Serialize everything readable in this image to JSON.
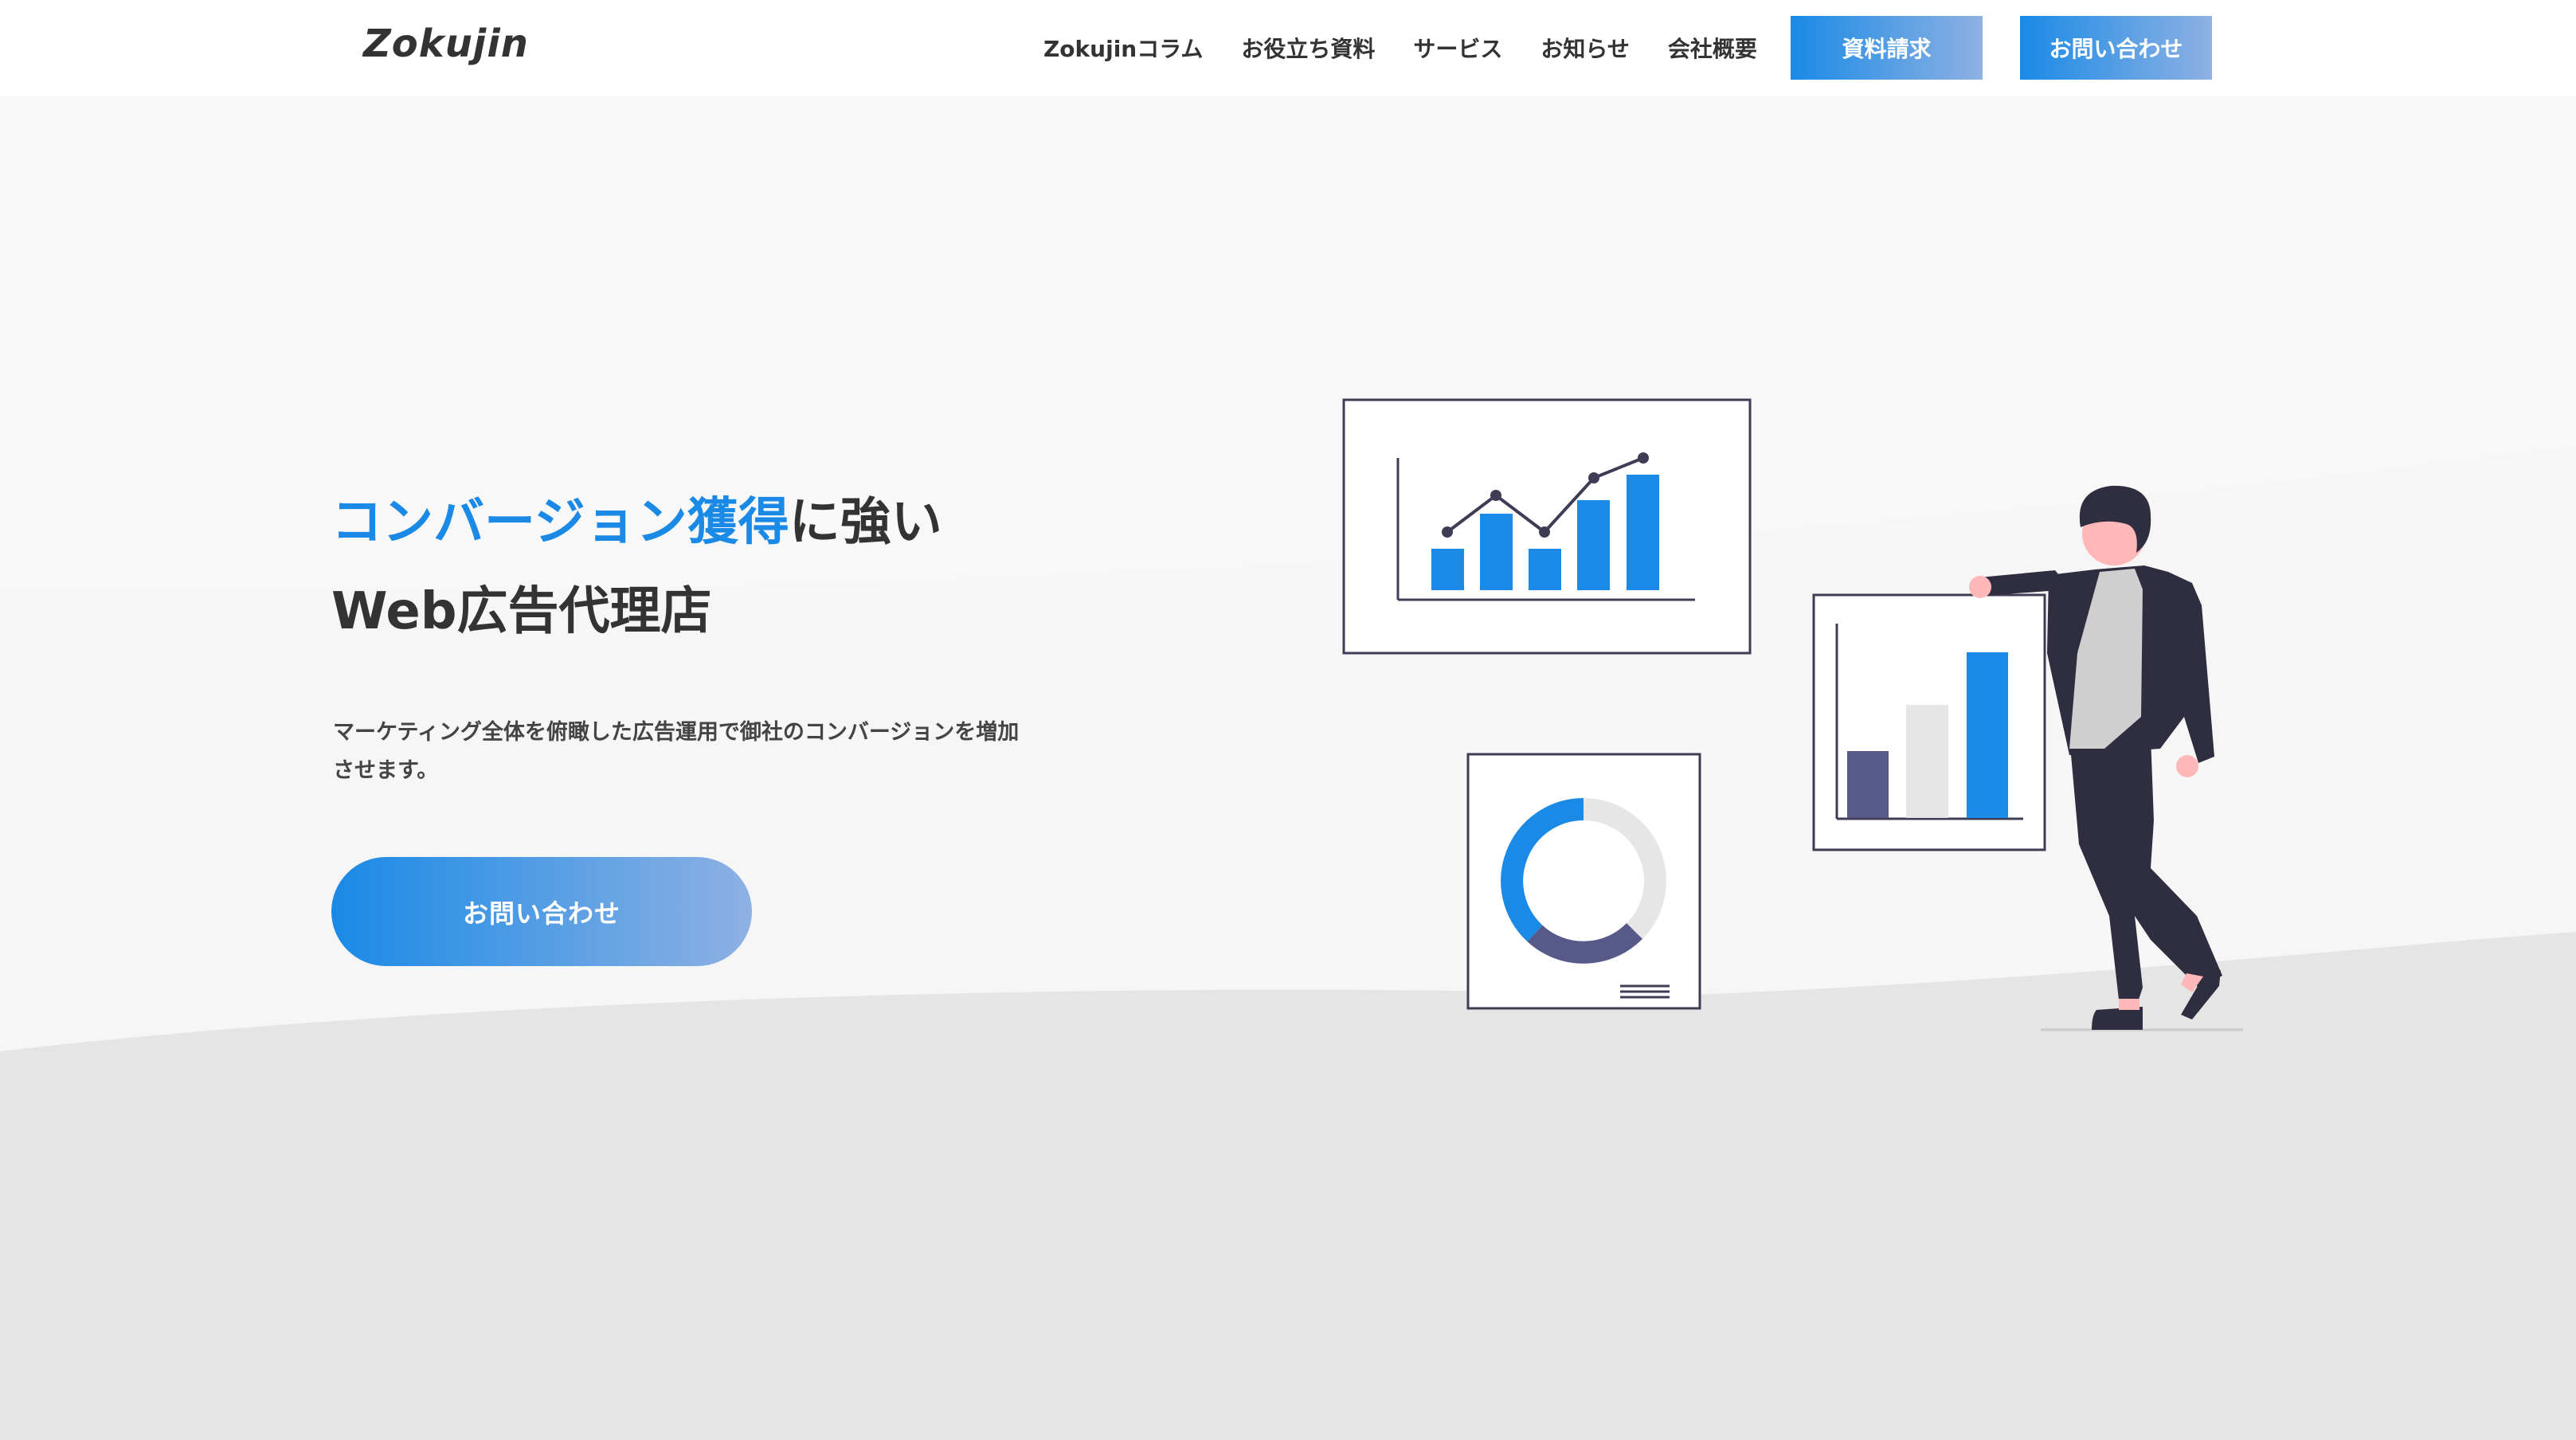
{
  "header": {
    "logo": "Zokujin",
    "nav": [
      {
        "label": "Zokujinコラム"
      },
      {
        "label": "お役立ち資料"
      },
      {
        "label": "サービス"
      },
      {
        "label": "お知らせ"
      },
      {
        "label": "会社概要"
      }
    ],
    "request_button": "資料請求",
    "contact_button": "お問い合わせ"
  },
  "hero": {
    "title_accent": "コンバージョン獲得",
    "title_rest": "に強い",
    "title_line2": "Web広告代理店",
    "description": "マーケティング全体を俯瞰した広告運用で御社のコンバージョンを増加させます。",
    "cta_label": "お問い合わせ"
  },
  "colors": {
    "accent": "#1a8ae6",
    "gradient_end": "#8eb1e3",
    "dark_navy": "#575a89",
    "figure_dark": "#2f2e41",
    "light_gray": "#e6e6e6"
  },
  "illustration": {
    "icons": [
      "line-bar-chart-icon",
      "donut-chart-icon",
      "bar-chart-icon",
      "businessman-figure"
    ]
  }
}
